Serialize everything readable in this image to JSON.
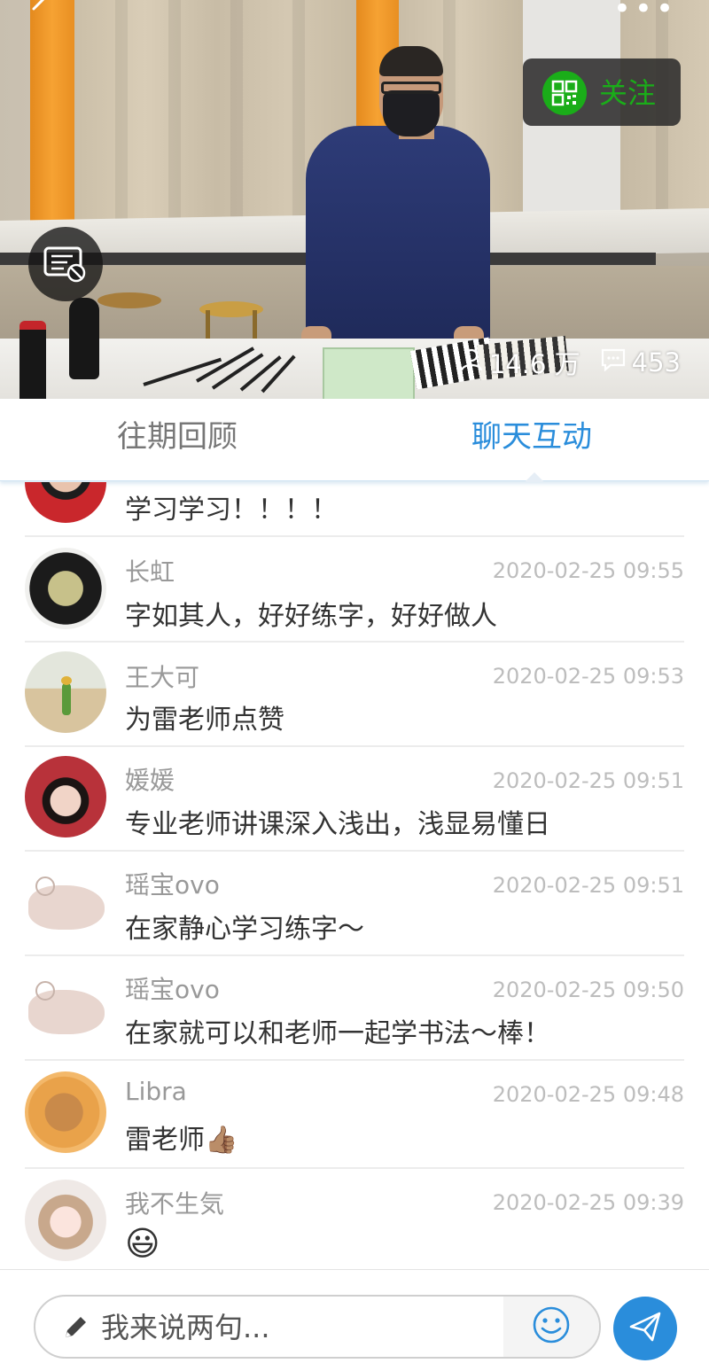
{
  "video": {
    "follow_label": "关注",
    "viewers": "14.6 万",
    "comments": "453"
  },
  "tabs": [
    {
      "label": "往期回顾",
      "active": false
    },
    {
      "label": "聊天互动",
      "active": true
    }
  ],
  "messages": [
    {
      "name": "",
      "time": "",
      "text": "学习学习！！！！",
      "avatar": "man-red-avatar"
    },
    {
      "name": "长虹",
      "time": "2020-02-25 09:55",
      "text": "字如其人，好好练字，好好做人",
      "avatar": "woman-glasses-avatar"
    },
    {
      "name": "王大可",
      "time": "2020-02-25 09:53",
      "text": "为雷老师点赞",
      "avatar": "little-prince-avatar"
    },
    {
      "name": "媛媛",
      "time": "2020-02-25 09:51",
      "text": "专业老师讲课深入浅出，浅显易懂日",
      "avatar": "opera-woman-avatar"
    },
    {
      "name": "瑶宝ovo",
      "time": "2020-02-25 09:51",
      "text": "在家静心学习练字～",
      "avatar": "bear-sketch-avatar"
    },
    {
      "name": "瑶宝ovo",
      "time": "2020-02-25 09:50",
      "text": "在家就可以和老师一起学书法～棒！",
      "avatar": "bear-sketch-avatar"
    },
    {
      "name": "Libra",
      "time": "2020-02-25 09:48",
      "text": "雷老师👍🏽",
      "avatar": "dog-avatar"
    },
    {
      "name": "我不生気",
      "time": "2020-02-25 09:39",
      "text": "😃",
      "avatar": "anime-girl-avatar"
    }
  ],
  "input": {
    "placeholder": "我来说两句..."
  },
  "colors": {
    "accent": "#2a8ddb",
    "follow_green": "#1aad19"
  }
}
